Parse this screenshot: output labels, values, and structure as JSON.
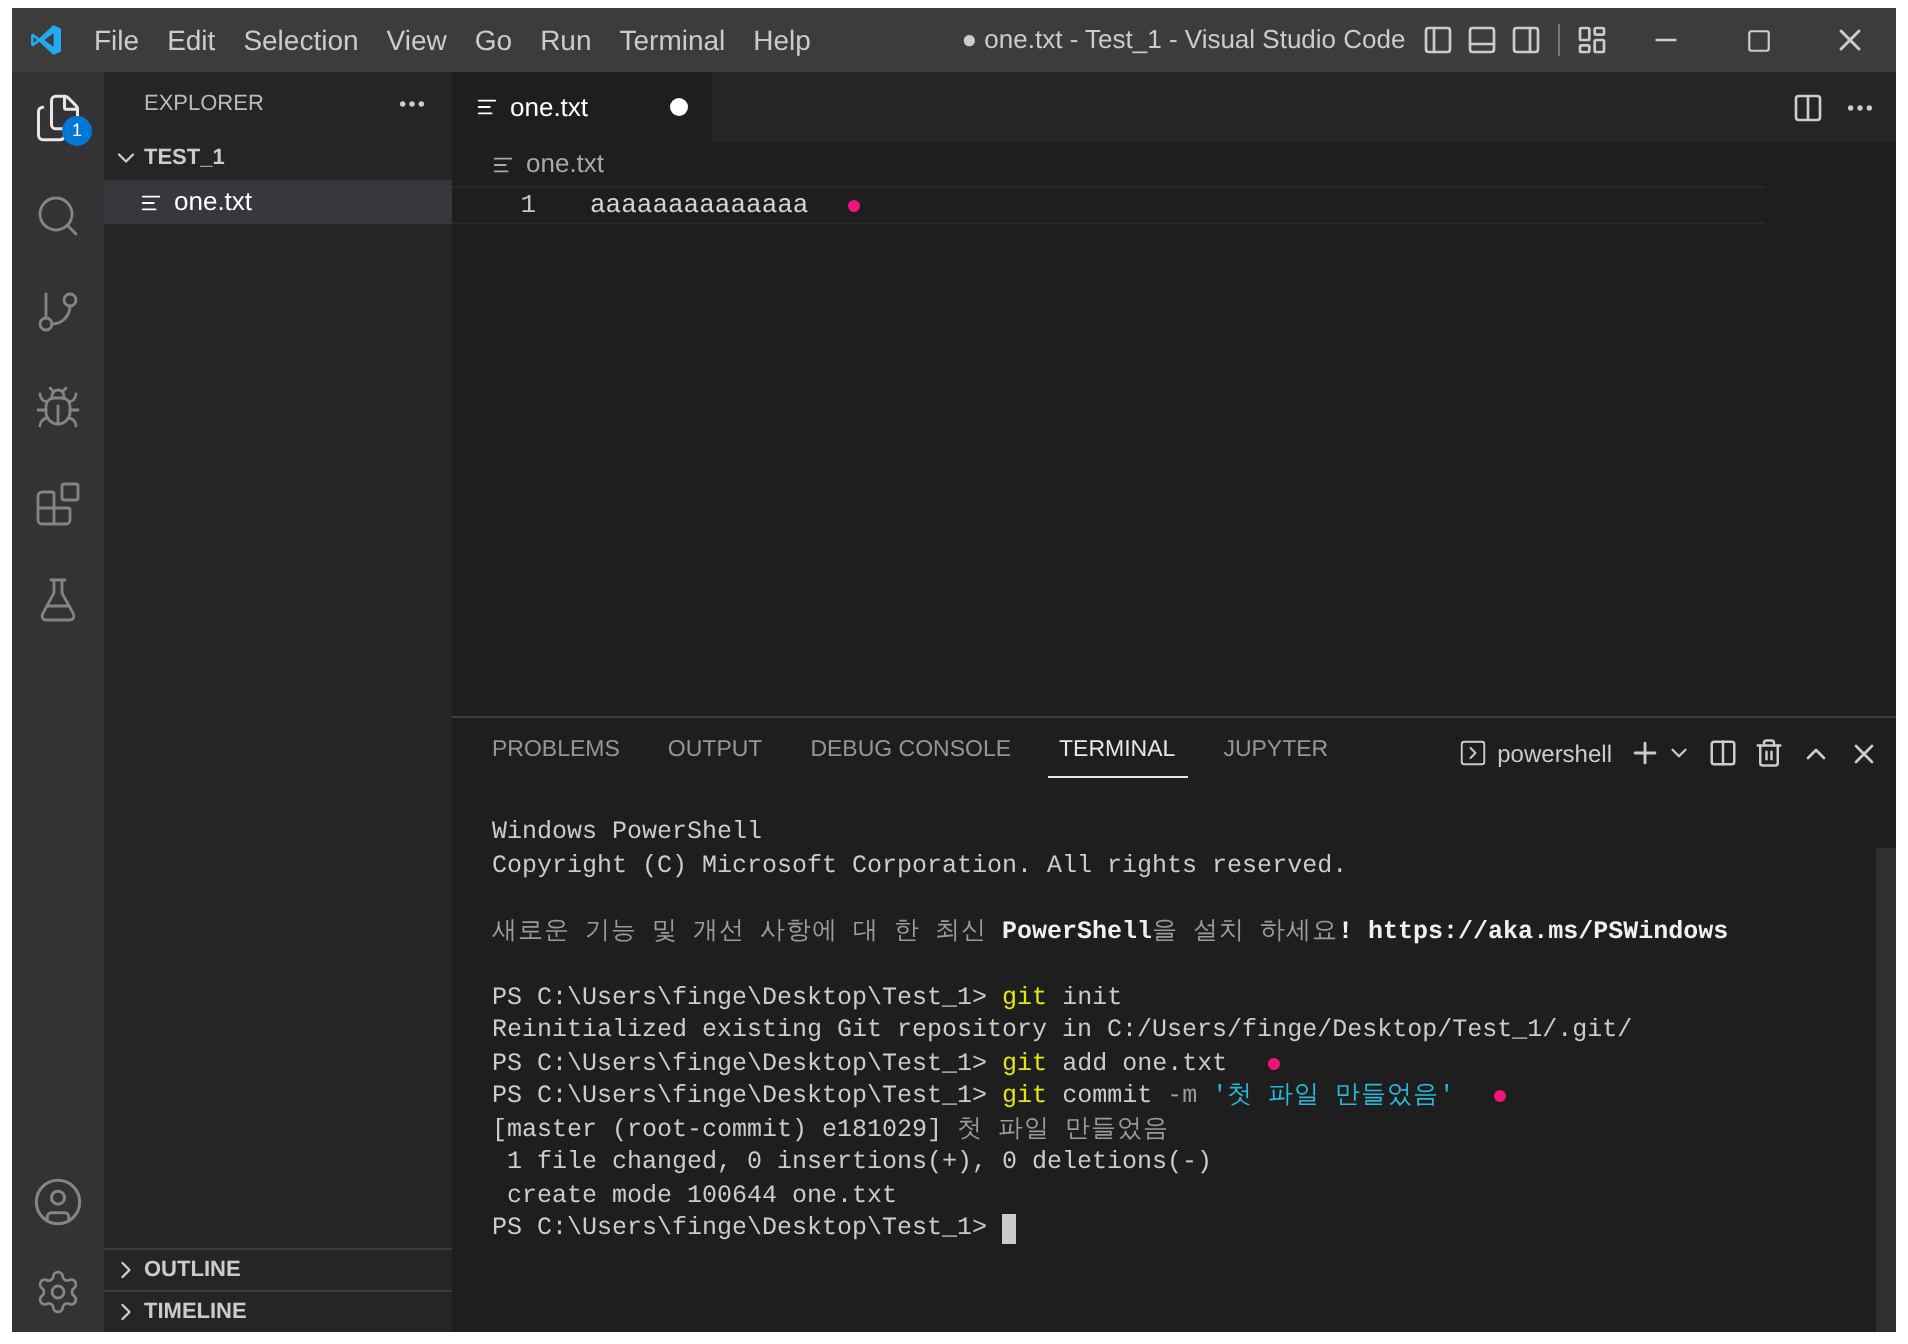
{
  "menu": [
    "File",
    "Edit",
    "Selection",
    "View",
    "Go",
    "Run",
    "Terminal",
    "Help"
  ],
  "window": {
    "title": "● one.txt - Test_1 - Visual Studio Code"
  },
  "activity_bar": {
    "explorer_badge": "1"
  },
  "sidebar": {
    "title": "EXPLORER",
    "folder": {
      "label": "TEST_1",
      "expanded": true,
      "children": [
        {
          "label": "one.txt",
          "selected": true
        }
      ]
    },
    "sections": [
      {
        "label": "OUTLINE",
        "expanded": false
      },
      {
        "label": "TIMELINE",
        "expanded": false
      }
    ]
  },
  "editor": {
    "tabs": [
      {
        "label": "one.txt",
        "selected": true,
        "modified": true
      }
    ],
    "breadcrumb": "one.txt",
    "lines": [
      {
        "number": "1",
        "text": "aaaaaaaaaaaaaa",
        "marked": true
      }
    ]
  },
  "panel": {
    "tabs": [
      {
        "label": "PROBLEMS",
        "selected": false
      },
      {
        "label": "OUTPUT",
        "selected": false
      },
      {
        "label": "DEBUG CONSOLE",
        "selected": false
      },
      {
        "label": "TERMINAL",
        "selected": true
      },
      {
        "label": "JUPYTER",
        "selected": false
      }
    ],
    "terminal_name": "powershell",
    "lines": [
      {
        "segments": [
          {
            "kind": "text",
            "text": "Windows PowerShell"
          }
        ],
        "marked": false
      },
      {
        "segments": [
          {
            "kind": "text",
            "text": "Copyright (C) Microsoft Corporation. All rights reserved."
          }
        ],
        "marked": false
      },
      {
        "marked": false
      },
      {
        "segments": [
          {
            "kind": "dim",
            "text": "새로운 기능 및 개선 사항에 대 한 최신 "
          },
          {
            "kind": "emphasis",
            "text": "PowerShell"
          },
          {
            "kind": "dim",
            "text": "을 설치 하세요"
          },
          {
            "kind": "emphasis",
            "text": "! https://aka.ms/PSWindows"
          }
        ],
        "marked": false
      },
      {
        "marked": false
      },
      {
        "segments": [
          {
            "kind": "text",
            "text": "PS C:\\Users\\finge\\Desktop\\Test_1> "
          },
          {
            "kind": "command",
            "text": "git"
          },
          {
            "kind": "text",
            "text": " init"
          }
        ],
        "marked": false
      },
      {
        "segments": [
          {
            "kind": "text",
            "text": "Reinitialized existing Git repository in C:/Users/finge/Desktop/Test_1/.git/"
          }
        ],
        "marked": false
      },
      {
        "segments": [
          {
            "kind": "text",
            "text": "PS C:\\Users\\finge\\Desktop\\Test_1> "
          },
          {
            "kind": "command",
            "text": "git"
          },
          {
            "kind": "text",
            "text": " add one.txt"
          }
        ],
        "marked": true
      },
      {
        "segments": [
          {
            "kind": "text",
            "text": "PS C:\\Users\\finge\\Desktop\\Test_1> "
          },
          {
            "kind": "command",
            "text": "git"
          },
          {
            "kind": "text",
            "text": " commit "
          },
          {
            "kind": "flag",
            "text": "-m"
          },
          {
            "kind": "string",
            "text": " '첫 파일 만들었음'"
          }
        ],
        "marked": true
      },
      {
        "segments": [
          {
            "kind": "text",
            "text": "[master (root-commit) e181029] "
          },
          {
            "kind": "dim",
            "text": "첫 파일 만들었음"
          }
        ],
        "marked": false
      },
      {
        "segments": [
          {
            "kind": "text",
            "text": " 1 file changed, 0 insertions(+), 0 deletions(-)"
          }
        ],
        "marked": false
      },
      {
        "segments": [
          {
            "kind": "text",
            "text": " create mode 100644 one.txt"
          }
        ],
        "marked": false
      },
      {
        "segments": [
          {
            "kind": "text",
            "text": "PS C:\\Users\\finge\\Desktop\\Test_1> "
          }
        ],
        "marked": false,
        "cursor": true
      }
    ]
  }
}
